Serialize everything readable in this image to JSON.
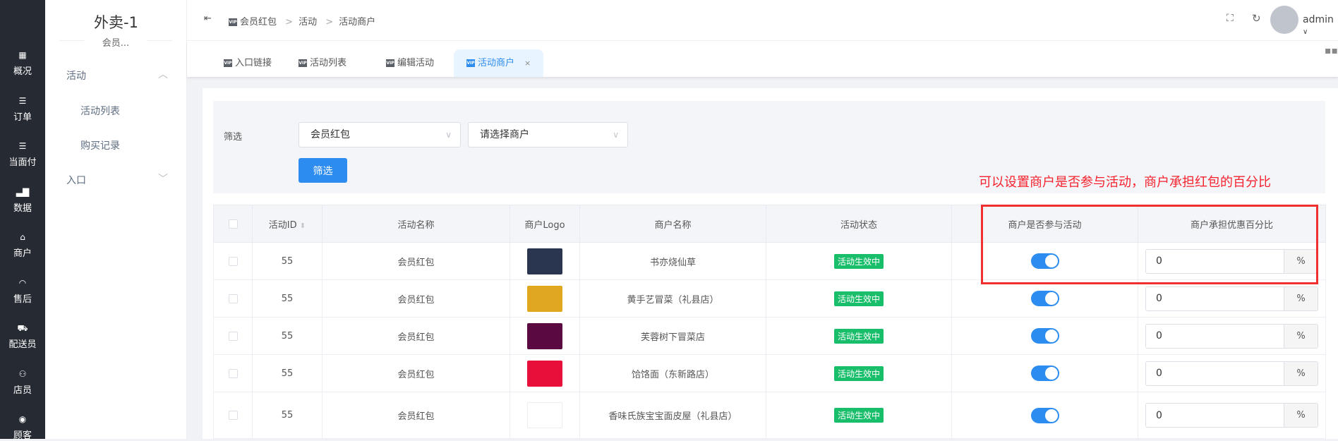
{
  "nav": [
    {
      "label": "概况",
      "icon": "dashboard-icon"
    },
    {
      "label": "订单",
      "icon": "list-icon"
    },
    {
      "label": "当面付",
      "icon": "list-icon"
    },
    {
      "label": "数据",
      "icon": "bar-chart-icon"
    },
    {
      "label": "商户",
      "icon": "store-icon"
    },
    {
      "label": "售后",
      "icon": "headset-icon"
    },
    {
      "label": "配送员",
      "icon": "delivery-icon"
    },
    {
      "label": "店员",
      "icon": "users-icon"
    },
    {
      "label": "顾客",
      "icon": "user-circle-icon"
    }
  ],
  "side": {
    "title": "外卖-1",
    "subtitle": "会员...",
    "menu": [
      {
        "label": "活动"
      },
      {
        "label": "活动列表"
      },
      {
        "label": "购买记录"
      },
      {
        "label": "入口"
      }
    ]
  },
  "header": {
    "breadcrumb": [
      "会员红包",
      "活动",
      "活动商户"
    ],
    "sep": ">",
    "user": "admin"
  },
  "tabs": [
    {
      "label": "入口链接"
    },
    {
      "label": "活动列表"
    },
    {
      "label": "编辑活动"
    },
    {
      "label": "活动商户"
    }
  ],
  "filter": {
    "label": "筛选",
    "select1": "会员红包",
    "select2_placeholder": "请选择商户",
    "button": "筛选"
  },
  "annotation": "可以设置商户是否参与活动，商户承担红包的百分比",
  "table": {
    "headers": [
      "活动ID",
      "活动名称",
      "商户Logo",
      "商户名称",
      "活动状态",
      "商户是否参与活动",
      "商户承担优惠百分比"
    ],
    "rows": [
      {
        "id": "55",
        "name": "会员红包",
        "merchant": "书亦烧仙草",
        "status": "活动生效中",
        "enabled": true,
        "percent": "0",
        "logo_color": "#2a3550"
      },
      {
        "id": "55",
        "name": "会员红包",
        "merchant": "黄手艺冒菜（礼县店）",
        "status": "活动生效中",
        "enabled": true,
        "percent": "0",
        "logo_color": "#e0a820"
      },
      {
        "id": "55",
        "name": "会员红包",
        "merchant": "芙蓉树下冒菜店",
        "status": "活动生效中",
        "enabled": true,
        "percent": "0",
        "logo_color": "#5a0a40"
      },
      {
        "id": "55",
        "name": "会员红包",
        "merchant": "饸饹面（东新路店）",
        "status": "活动生效中",
        "enabled": true,
        "percent": "0",
        "logo_color": "#e8103a"
      },
      {
        "id": "55",
        "name": "会员红包",
        "merchant": "香味氏族宝宝面皮屋（礼县店）",
        "status": "活动生效中",
        "enabled": true,
        "percent": "0",
        "logo_color": "#ffffff"
      }
    ],
    "unit": "%"
  }
}
